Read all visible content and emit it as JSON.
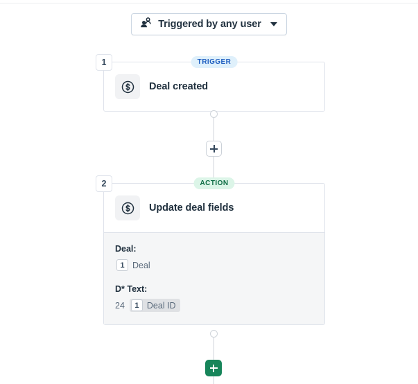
{
  "enrollment": {
    "label": "Triggered by any user",
    "icon": "users-icon",
    "caret": "chevron-down-icon"
  },
  "steps": [
    {
      "number": "1",
      "type_label": "TRIGGER",
      "type": "trigger",
      "icon": "dollar-circle-icon",
      "title": "Deal created"
    },
    {
      "number": "2",
      "type_label": "ACTION",
      "type": "action",
      "icon": "dollar-circle-icon",
      "title": "Update deal fields",
      "fields": [
        {
          "label": "Deal:",
          "prefix": "",
          "token_badge": "1",
          "token_text": "Deal",
          "chip": false
        },
        {
          "label": "D* Text:",
          "prefix": "24",
          "token_badge": "1",
          "token_text": "Deal ID",
          "chip": true
        }
      ]
    }
  ],
  "buttons": {
    "add_step_label": "+",
    "add_step_end_label": "+"
  },
  "colors": {
    "trigger_badge_bg": "#dff0fb",
    "trigger_badge_text": "#1c5cbf",
    "action_badge_bg": "#dcf5e8",
    "action_badge_text": "#0c6b43",
    "green_button": "#17855a",
    "card_border": "#dfe3eb",
    "panel_bg": "#f5f6f7"
  }
}
